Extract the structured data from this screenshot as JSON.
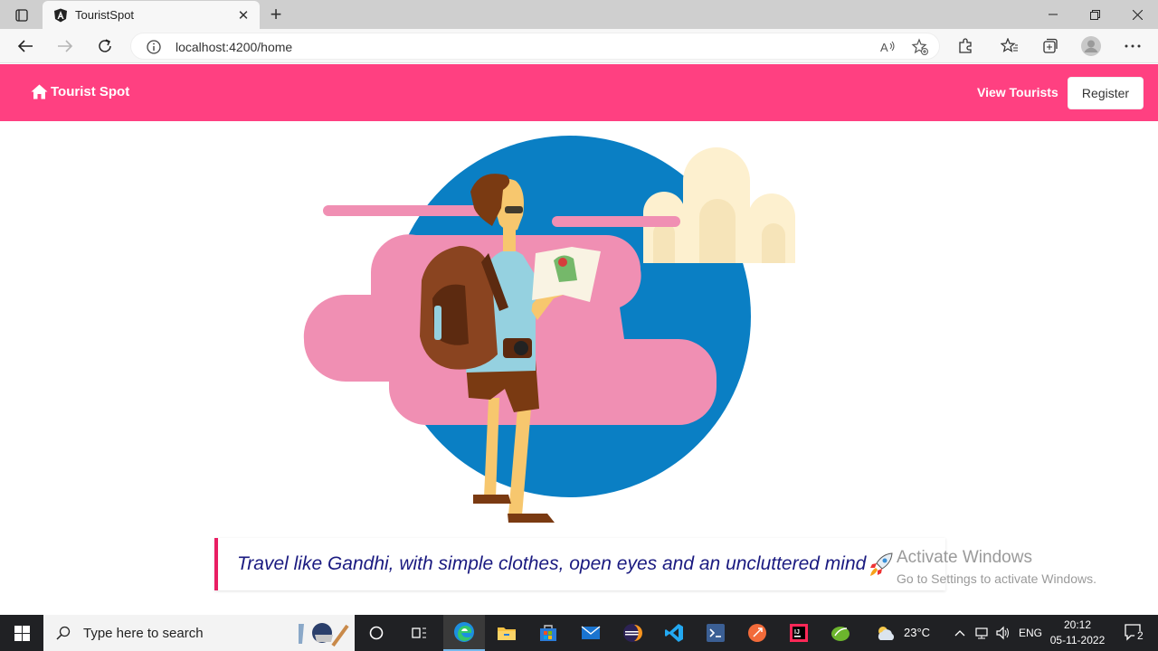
{
  "browser": {
    "tab_title": "TouristSpot",
    "url": "localhost:4200/home"
  },
  "navbar": {
    "brand": "Tourist Spot",
    "view_tourists": "View Tourists",
    "register": "Register",
    "accent_color": "#ff4081"
  },
  "hero": {
    "illustration": "traveler-with-map-illustration"
  },
  "quote": {
    "text": "Travel like Gandhi, with simple clothes, open eyes and an uncluttered mind",
    "emoji": "rocket-icon",
    "border_color": "#e91e63",
    "text_color": "#1a1a80"
  },
  "watermark": {
    "title": "Activate Windows",
    "subtitle": "Go to Settings to activate Windows."
  },
  "taskbar": {
    "search_placeholder": "Type here to search",
    "temperature": "23°C",
    "language": "ENG",
    "time": "20:12",
    "date": "05-11-2022",
    "notifications": "2"
  }
}
